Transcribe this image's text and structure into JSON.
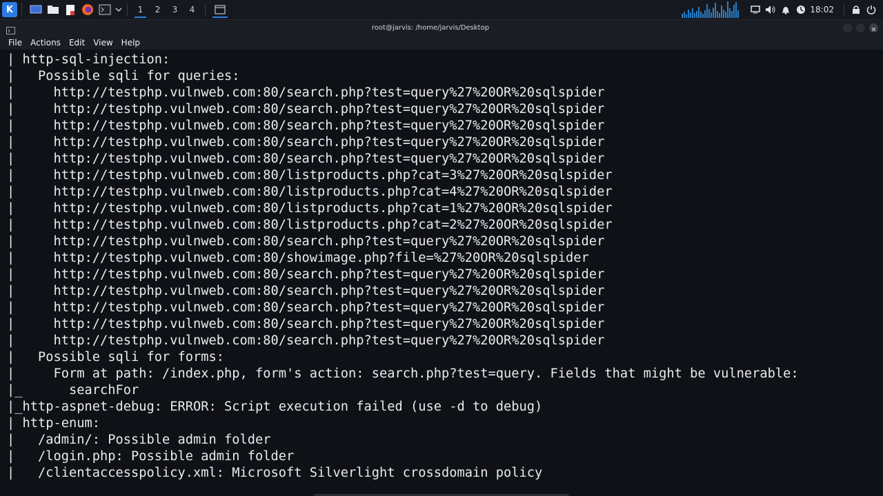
{
  "taskbar": {
    "workspaces": [
      "1",
      "2",
      "3",
      "4"
    ],
    "active_workspace": "1",
    "clock": "18:02",
    "icons": [
      "kali-menu-icon",
      "desktop-icon",
      "file-manager-icon",
      "text-editor-icon",
      "firefox-icon",
      "terminal-icon",
      "chevron-down-icon"
    ],
    "tray_icons": [
      "display-icon",
      "volume-icon",
      "bell-icon",
      "update-icon",
      "lock-icon",
      "power-icon"
    ]
  },
  "window": {
    "title": "root@jarvis: /home/jarvis/Desktop"
  },
  "menubar": {
    "items": [
      "File",
      "Actions",
      "Edit",
      "View",
      "Help"
    ]
  },
  "terminal": {
    "lines": [
      "| http-sql-injection:",
      "|   Possible sqli for queries:",
      "|     http://testphp.vulnweb.com:80/search.php?test=query%27%20OR%20sqlspider",
      "|     http://testphp.vulnweb.com:80/search.php?test=query%27%20OR%20sqlspider",
      "|     http://testphp.vulnweb.com:80/search.php?test=query%27%20OR%20sqlspider",
      "|     http://testphp.vulnweb.com:80/search.php?test=query%27%20OR%20sqlspider",
      "|     http://testphp.vulnweb.com:80/search.php?test=query%27%20OR%20sqlspider",
      "|     http://testphp.vulnweb.com:80/listproducts.php?cat=3%27%20OR%20sqlspider",
      "|     http://testphp.vulnweb.com:80/listproducts.php?cat=4%27%20OR%20sqlspider",
      "|     http://testphp.vulnweb.com:80/listproducts.php?cat=1%27%20OR%20sqlspider",
      "|     http://testphp.vulnweb.com:80/listproducts.php?cat=2%27%20OR%20sqlspider",
      "|     http://testphp.vulnweb.com:80/search.php?test=query%27%20OR%20sqlspider",
      "|     http://testphp.vulnweb.com:80/showimage.php?file=%27%20OR%20sqlspider",
      "|     http://testphp.vulnweb.com:80/search.php?test=query%27%20OR%20sqlspider",
      "|     http://testphp.vulnweb.com:80/search.php?test=query%27%20OR%20sqlspider",
      "|     http://testphp.vulnweb.com:80/search.php?test=query%27%20OR%20sqlspider",
      "|     http://testphp.vulnweb.com:80/search.php?test=query%27%20OR%20sqlspider",
      "|     http://testphp.vulnweb.com:80/search.php?test=query%27%20OR%20sqlspider",
      "|   Possible sqli for forms:",
      "|     Form at path: /index.php, form's action: search.php?test=query. Fields that might be vulnerable:",
      "|_      searchFor",
      "|_http-aspnet-debug: ERROR: Script execution failed (use -d to debug)",
      "| http-enum:",
      "|   /admin/: Possible admin folder",
      "|   /login.php: Possible admin folder",
      "|   /clientaccesspolicy.xml: Microsoft Silverlight crossdomain policy"
    ]
  }
}
